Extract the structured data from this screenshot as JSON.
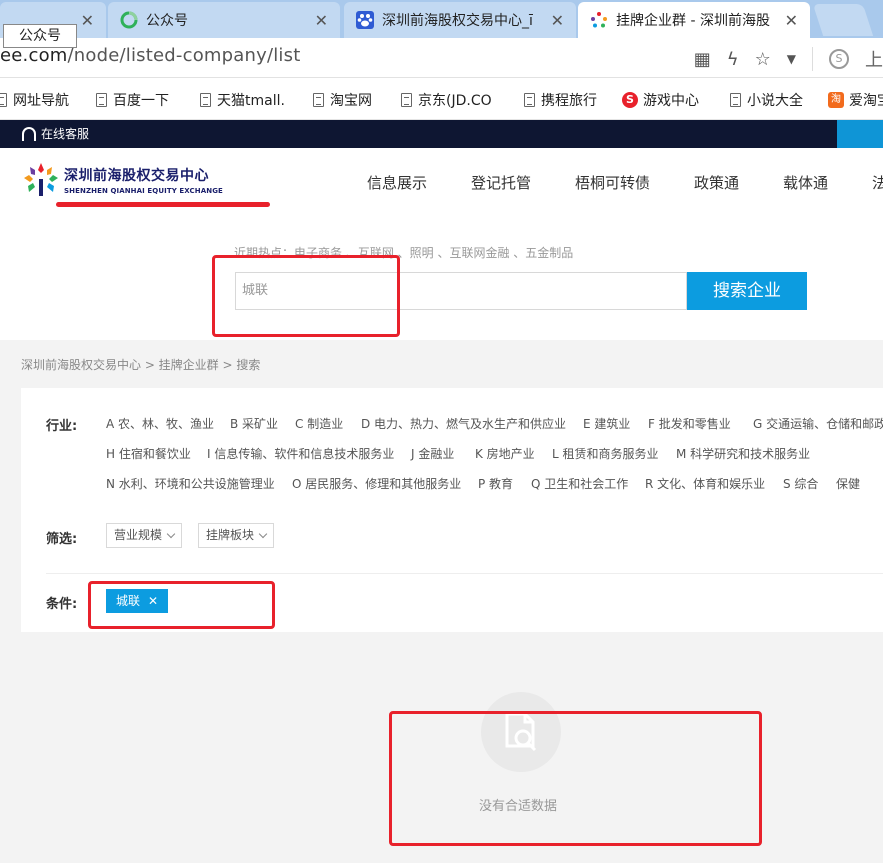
{
  "browser": {
    "tooltip": "公众号",
    "tabs": [
      {
        "title": "",
        "active": false
      },
      {
        "title": "公众号",
        "active": false
      },
      {
        "title": "深圳前海股权交易中心_ī",
        "active": false
      },
      {
        "title": "挂牌企业群 - 深圳前海股",
        "active": true
      }
    ],
    "url_host": "ee.com",
    "url_path": "/node/listed-company/list",
    "right_char": "上",
    "bookmarks": [
      "网址导航",
      "百度一下",
      "天猫tmall.",
      "淘宝网",
      "京东(JD.CO",
      "携程旅行",
      "游戏中心",
      "小说大全",
      "爱淘宝"
    ]
  },
  "site": {
    "customer_service": "在线客服",
    "logo_cn": "深圳前海股权交易中心",
    "logo_en": "SHENZHEN QIANHAI EQUITY EXCHANGE",
    "nav": [
      "信息展示",
      "登记托管",
      "梧桐可转债",
      "政策通",
      "载体通",
      "法"
    ],
    "hot_keywords": "近期热点：电子商务 、互联网 、照明 、互联网金融 、五金制品",
    "search_value": "城联",
    "search_button": "搜索企业",
    "breadcrumb": "深圳前海股权交易中心 > 挂牌企业群 > 搜索"
  },
  "filters": {
    "industry_label": "行业:",
    "industries": [
      "A 农、林、牧、渔业",
      "B 采矿业",
      "C 制造业",
      "D 电力、热力、燃气及水生产和供应业",
      "E 建筑业",
      "F 批发和零售业",
      "G 交通运输、仓储和邮政",
      "H 住宿和餐饮业",
      "I 信息传输、软件和信息技术服务业",
      "J 金融业",
      "K 房地产业",
      "L 租赁和商务服务业",
      "M 科学研究和技术服务业",
      "N 水利、环境和公共设施管理业",
      "O 居民服务、修理和其他服务业",
      "P 教育",
      "Q 卫生和社会工作",
      "R 文化、体育和娱乐业",
      "S 综合",
      "保健"
    ],
    "filter_label": "筛选:",
    "dropdowns": [
      "营业规模",
      "挂牌板块"
    ],
    "condition_label": "条件:",
    "condition_tag": "城联"
  },
  "empty_state": {
    "text": "没有合适数据"
  },
  "colors": {
    "accent": "#0c9ce0",
    "annotation_red": "#e8212b",
    "top_strip": "#0e1632"
  }
}
